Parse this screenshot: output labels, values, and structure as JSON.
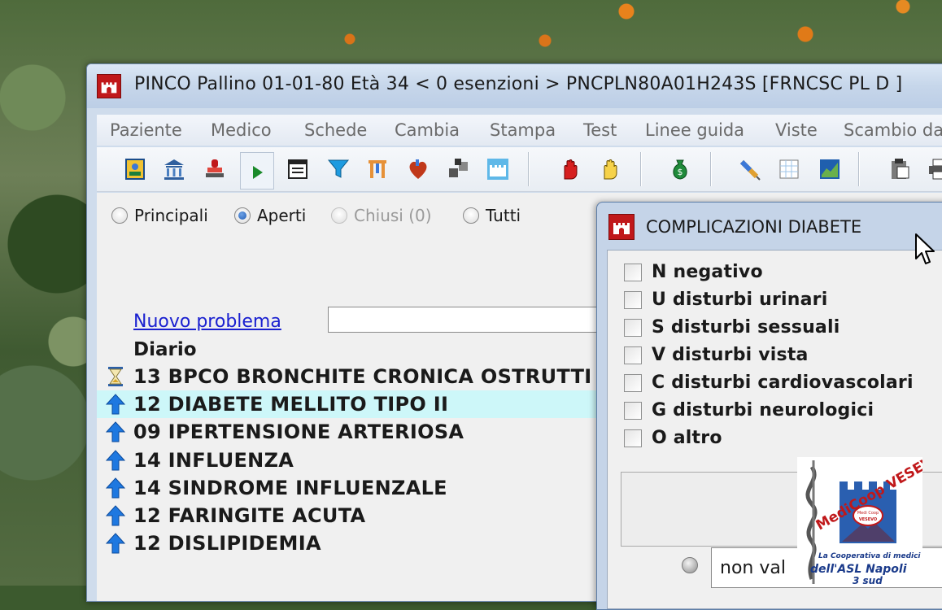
{
  "window": {
    "title": "PINCO Pallino  01-01-80  Età 34   < 0 esenzioni >   PNCPLN80A01H243S   [FRNCSC PL D ]"
  },
  "menu": [
    "Paziente",
    "Medico",
    "Schede",
    "Cambia",
    "Stampa",
    "Test",
    "Linee guida",
    "Viste",
    "Scambio da"
  ],
  "toolbar": [
    "patient-card-icon",
    "bank-icon",
    "stamp-icon",
    "play-icon",
    "form-icon",
    "filter-icon",
    "pins-icon",
    "heart-icon",
    "blocks-icon",
    "castle-icon",
    "red-hand-icon",
    "yellow-hand-icon",
    "money-bag-icon",
    "syringe-icon",
    "grid-icon",
    "chart-icon",
    "clipboard-icon",
    "printer-icon"
  ],
  "filters": {
    "principali": "Principali",
    "aperti": "Aperti",
    "chiusi": "Chiusi (0)",
    "tutti": "Tutti",
    "selected": "aperti"
  },
  "main": {
    "new_problem": "Nuovo problema",
    "diary": "Diario",
    "problems": [
      {
        "text": "13 BPCO BRONCHITE CRONICA OSTRUTTI",
        "icon": "hourglass-icon"
      },
      {
        "text": "12 DIABETE MELLITO TIPO II",
        "icon": "up-arrow-icon",
        "selected": true
      },
      {
        "text": "09 IPERTENSIONE ARTERIOSA",
        "icon": "up-arrow-icon"
      },
      {
        "text": "14 INFLUENZA",
        "icon": "up-arrow-icon"
      },
      {
        "text": "14 SINDROME INFLUENZALE",
        "icon": "up-arrow-icon"
      },
      {
        "text": "12 FARINGITE ACUTA",
        "icon": "up-arrow-icon"
      },
      {
        "text": "12 DISLIPIDEMIA",
        "icon": "up-arrow-icon"
      }
    ]
  },
  "dialog": {
    "title": "COMPLICAZIONI DIABETE",
    "options": [
      "N negativo",
      "U disturbi urinari",
      "S disturbi sessuali",
      "V disturbi vista",
      "C disturbi cardiovascolari",
      "G disturbi neurologici",
      "O altro"
    ],
    "status": "non val"
  },
  "logo": {
    "name": "MediCoop VESEVO",
    "badge_top": "Medi Coop",
    "badge_bottom": "VESEVO",
    "line1": "La Cooperativa di medici",
    "line2": "dell'ASL Napoli",
    "line3": "3 sud"
  },
  "colors": {
    "accent_red": "#c0181a",
    "selection": "#cdf7f9",
    "link": "#1a20d0",
    "arrow_blue": "#1e78e0"
  }
}
